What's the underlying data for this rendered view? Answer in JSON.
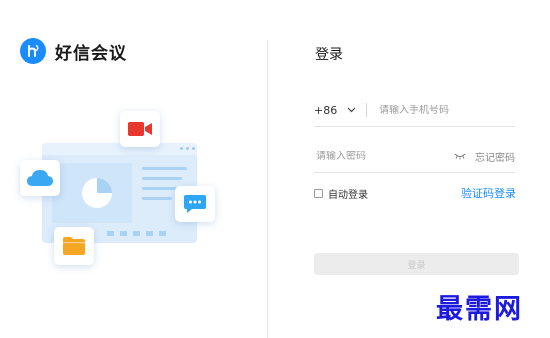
{
  "brand": {
    "name": "好信会议",
    "logo_icon": "hi-logo-icon",
    "color": "#1a8cff"
  },
  "illustration": {
    "icons": [
      "video-camera-icon",
      "cloud-icon",
      "pie-chart-icon",
      "chat-bubble-icon",
      "folder-icon"
    ]
  },
  "login": {
    "title": "登录",
    "country_code": "+86",
    "phone_placeholder": "请输入手机号码",
    "password_placeholder": "请输入密码",
    "forgot_password": "忘记密码",
    "auto_login": "自动登录",
    "sms_login": "验证码登录",
    "login_button": "登录"
  },
  "watermark": "最需网",
  "colors": {
    "accent": "#1a8cff",
    "video": "#e8372f",
    "folder": "#f5a623",
    "chat": "#2ea6f5",
    "cloud": "#3aa8f2"
  }
}
